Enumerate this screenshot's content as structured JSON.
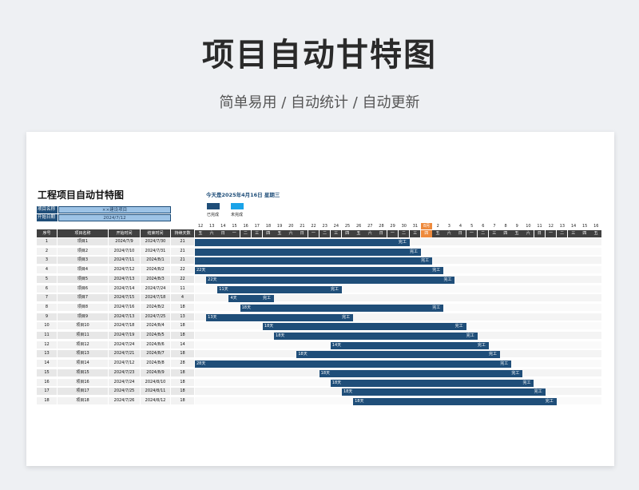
{
  "hero": {
    "title": "项目自动甘特图",
    "subtitle": "简单易用 / 自动统计 / 自动更新"
  },
  "sheet": {
    "title": "工程项目自动甘特图",
    "project_name_label": "项目名称",
    "project_name": "××建设项目",
    "start_date_label": "开始日期",
    "start_date": "2024/7/12",
    "today_text": "今天是2025年4月16日 星期三",
    "legend": {
      "done": "已完成",
      "todo": "未完成",
      "done_color": "#1f4e79",
      "todo_color": "#1aa3e8"
    }
  },
  "table": {
    "headers": [
      "序号",
      "项目名称",
      "开始时间",
      "结束时间",
      "持续天数"
    ],
    "day_numbers": [
      "12",
      "13",
      "14",
      "15",
      "16",
      "17",
      "18",
      "19",
      "20",
      "21",
      "22",
      "23",
      "24",
      "25",
      "26",
      "27",
      "28",
      "29",
      "30",
      "31",
      "8月",
      "2",
      "3",
      "4",
      "5",
      "6",
      "7",
      "8",
      "9",
      "10",
      "11",
      "12",
      "13",
      "14",
      "15",
      "16"
    ],
    "weekdays": [
      "五",
      "六",
      "日",
      "一",
      "二",
      "三",
      "四",
      "五",
      "六",
      "日",
      "一",
      "二",
      "三",
      "四",
      "五",
      "六",
      "日",
      "一",
      "二",
      "三",
      "四",
      "五",
      "六",
      "日",
      "一",
      "二",
      "三",
      "四",
      "五",
      "六",
      "日",
      "一",
      "二",
      "三",
      "四",
      "五"
    ],
    "today_index": 20,
    "rows": [
      {
        "no": "1",
        "name": "项目1",
        "start": "2024/7/9",
        "end": "2024/7/30",
        "days": "21",
        "bar_start": 0,
        "bar_len": 19,
        "label": "",
        "done_label": "完工"
      },
      {
        "no": "2",
        "name": "项目2",
        "start": "2024/7/10",
        "end": "2024/7/31",
        "days": "21",
        "bar_start": 0,
        "bar_len": 20,
        "label": "",
        "done_label": "完工"
      },
      {
        "no": "3",
        "name": "项目3",
        "start": "2024/7/11",
        "end": "2024/8/1",
        "days": "21",
        "bar_start": 0,
        "bar_len": 21,
        "label": "",
        "done_label": "完工"
      },
      {
        "no": "4",
        "name": "项目4",
        "start": "2024/7/12",
        "end": "2024/8/2",
        "days": "22",
        "bar_start": 0,
        "bar_len": 22,
        "label": "22天",
        "done_label": "完工"
      },
      {
        "no": "5",
        "name": "项目5",
        "start": "2024/7/13",
        "end": "2024/8/3",
        "days": "22",
        "bar_start": 1,
        "bar_len": 22,
        "label": "22天",
        "done_label": "完工"
      },
      {
        "no": "6",
        "name": "项目6",
        "start": "2024/7/14",
        "end": "2024/7/24",
        "days": "11",
        "bar_start": 2,
        "bar_len": 11,
        "label": "11天",
        "done_label": "完工"
      },
      {
        "no": "7",
        "name": "项目7",
        "start": "2024/7/15",
        "end": "2024/7/18",
        "days": "4",
        "bar_start": 3,
        "bar_len": 4,
        "label": "4天",
        "done_label": "完工"
      },
      {
        "no": "8",
        "name": "项目8",
        "start": "2024/7/16",
        "end": "2024/8/2",
        "days": "18",
        "bar_start": 4,
        "bar_len": 18,
        "label": "18天",
        "done_label": "完工"
      },
      {
        "no": "9",
        "name": "项目9",
        "start": "2024/7/13",
        "end": "2024/7/25",
        "days": "13",
        "bar_start": 1,
        "bar_len": 13,
        "label": "13天",
        "done_label": "完工"
      },
      {
        "no": "10",
        "name": "项目10",
        "start": "2024/7/18",
        "end": "2024/8/4",
        "days": "18",
        "bar_start": 6,
        "bar_len": 18,
        "label": "18天",
        "done_label": "完工"
      },
      {
        "no": "11",
        "name": "项目11",
        "start": "2024/7/19",
        "end": "2024/8/5",
        "days": "18",
        "bar_start": 7,
        "bar_len": 18,
        "label": "18天",
        "done_label": "完工"
      },
      {
        "no": "12",
        "name": "项目12",
        "start": "2024/7/24",
        "end": "2024/8/6",
        "days": "14",
        "bar_start": 12,
        "bar_len": 14,
        "label": "14天",
        "done_label": "完工"
      },
      {
        "no": "13",
        "name": "项目13",
        "start": "2024/7/21",
        "end": "2024/8/7",
        "days": "18",
        "bar_start": 9,
        "bar_len": 18,
        "label": "18天",
        "done_label": "完工"
      },
      {
        "no": "14",
        "name": "项目14",
        "start": "2024/7/12",
        "end": "2024/8/8",
        "days": "28",
        "bar_start": 0,
        "bar_len": 28,
        "label": "28天",
        "done_label": "完工"
      },
      {
        "no": "15",
        "name": "项目15",
        "start": "2024/7/23",
        "end": "2024/8/9",
        "days": "18",
        "bar_start": 11,
        "bar_len": 18,
        "label": "18天",
        "done_label": "完工"
      },
      {
        "no": "16",
        "name": "项目16",
        "start": "2024/7/24",
        "end": "2024/8/10",
        "days": "18",
        "bar_start": 12,
        "bar_len": 18,
        "label": "18天",
        "done_label": "完工"
      },
      {
        "no": "17",
        "name": "项目17",
        "start": "2024/7/25",
        "end": "2024/8/11",
        "days": "18",
        "bar_start": 13,
        "bar_len": 18,
        "label": "18天",
        "done_label": "完工"
      },
      {
        "no": "18",
        "name": "项目18",
        "start": "2024/7/26",
        "end": "2024/8/12",
        "days": "18",
        "bar_start": 14,
        "bar_len": 18,
        "label": "18天",
        "done_label": "完工"
      }
    ]
  }
}
